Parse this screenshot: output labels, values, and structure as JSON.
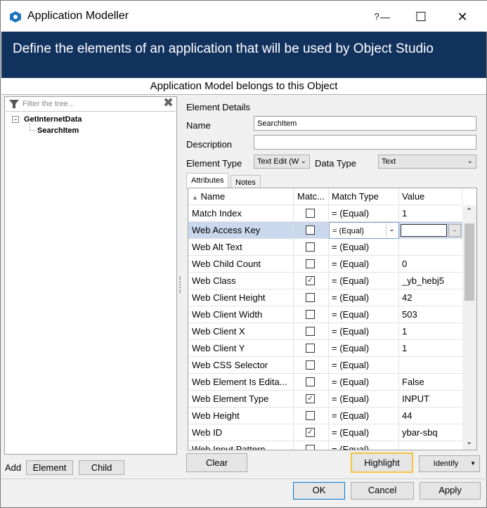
{
  "window": {
    "title": "Application Modeller",
    "help": "?",
    "minimize": "—",
    "maximize": "☐",
    "close": "✕"
  },
  "banner": "Define the elements of an application that will be used by Object Studio",
  "subbanner": "Application Model belongs to this Object",
  "tree": {
    "filter_placeholder": "Filter the tree...",
    "filter_clear": "✖",
    "root": "GetInternetData",
    "child": "SearchItem",
    "expander": "−"
  },
  "details": {
    "heading": "Element Details",
    "name_label": "Name",
    "name_value": "SearchItem",
    "description_label": "Description",
    "description_value": "",
    "element_type_label": "Element Type",
    "element_type_value": "Text Edit (W",
    "data_type_label": "Data Type",
    "data_type_value": "Text"
  },
  "tabs": [
    "Attributes",
    "Notes"
  ],
  "grid": {
    "columns": [
      "Name",
      "Matc...",
      "Match Type",
      "Value"
    ],
    "rows": [
      {
        "name": "Match Index",
        "checked": false,
        "match": "=  (Equal)",
        "value": "1"
      },
      {
        "name": "Web Access Key",
        "checked": false,
        "match": "=  (Equal)",
        "value": ""
      },
      {
        "name": "Web Alt Text",
        "checked": false,
        "match": "=  (Equal)",
        "value": ""
      },
      {
        "name": "Web Child Count",
        "checked": false,
        "match": "=  (Equal)",
        "value": "0"
      },
      {
        "name": "Web Class",
        "checked": true,
        "match": "=  (Equal)",
        "value": "_yb_hebj5"
      },
      {
        "name": "Web Client Height",
        "checked": false,
        "match": "=  (Equal)",
        "value": "42"
      },
      {
        "name": "Web Client Width",
        "checked": false,
        "match": "=  (Equal)",
        "value": "503"
      },
      {
        "name": "Web Client X",
        "checked": false,
        "match": "=  (Equal)",
        "value": "1"
      },
      {
        "name": "Web Client Y",
        "checked": false,
        "match": "=  (Equal)",
        "value": "1"
      },
      {
        "name": "Web CSS Selector",
        "checked": false,
        "match": "=  (Equal)",
        "value": ""
      },
      {
        "name": "Web Element Is Edita...",
        "checked": false,
        "match": "=  (Equal)",
        "value": "False"
      },
      {
        "name": "Web Element Type",
        "checked": true,
        "match": "=  (Equal)",
        "value": "INPUT"
      },
      {
        "name": "Web Height",
        "checked": false,
        "match": "=  (Equal)",
        "value": "44"
      },
      {
        "name": "Web ID",
        "checked": true,
        "match": "=  (Equal)",
        "value": "ybar-sbq"
      },
      {
        "name": "Web Input Pattern",
        "checked": false,
        "match": "=  (Equal)",
        "value": ""
      }
    ],
    "selected_match_combo": "=  (Equal)",
    "ellipsis": ".."
  },
  "bottom": {
    "add_label": "Add",
    "element_btn": "Element",
    "child_btn": "Child",
    "clear_btn": "Clear",
    "highlight_btn": "Highlight",
    "identify_btn": "Identify",
    "ok_btn": "OK",
    "cancel_btn": "Cancel",
    "apply_btn": "Apply"
  },
  "colors": {
    "banner": "#12325e",
    "selected_row": "#cad8ee",
    "highlight_border": "#f5c242"
  }
}
